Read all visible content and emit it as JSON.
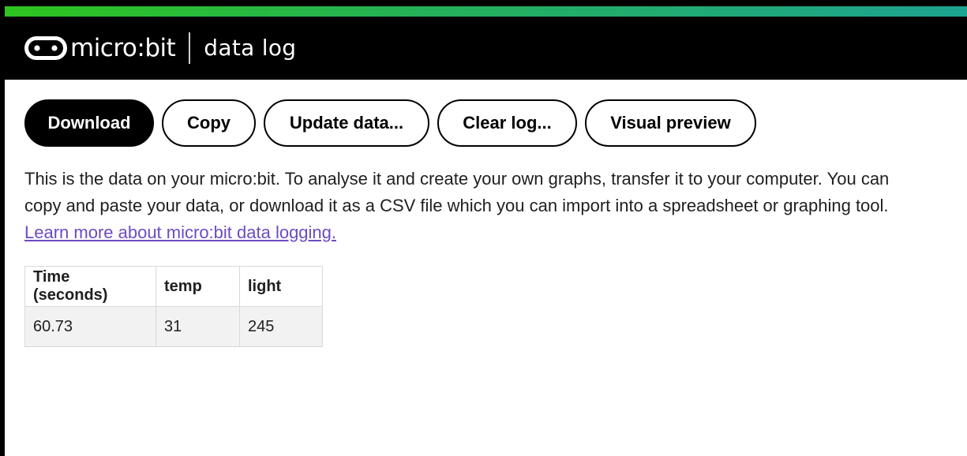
{
  "header": {
    "logo_text": "micro:bit",
    "app_title": "data log",
    "logo_icon": "microbit-face-icon",
    "gradient_colors": [
      "#2ec41e",
      "#1da391"
    ]
  },
  "toolbar": {
    "download_label": "Download",
    "copy_label": "Copy",
    "update_label": "Update data...",
    "clear_label": "Clear log...",
    "preview_label": "Visual preview"
  },
  "description": {
    "text": "This is the data on your micro:bit. To analyse it and create your own graphs, transfer it to your computer. You can copy and paste your data, or download it as a CSV file which you can import into a spreadsheet or graphing tool. ",
    "link_text": "Learn more about micro:bit data logging.",
    "link_color": "#6c4bc1"
  },
  "table": {
    "headers": [
      "Time (seconds)",
      "temp",
      "light"
    ],
    "rows": [
      [
        "60.73",
        "31",
        "245"
      ]
    ]
  }
}
